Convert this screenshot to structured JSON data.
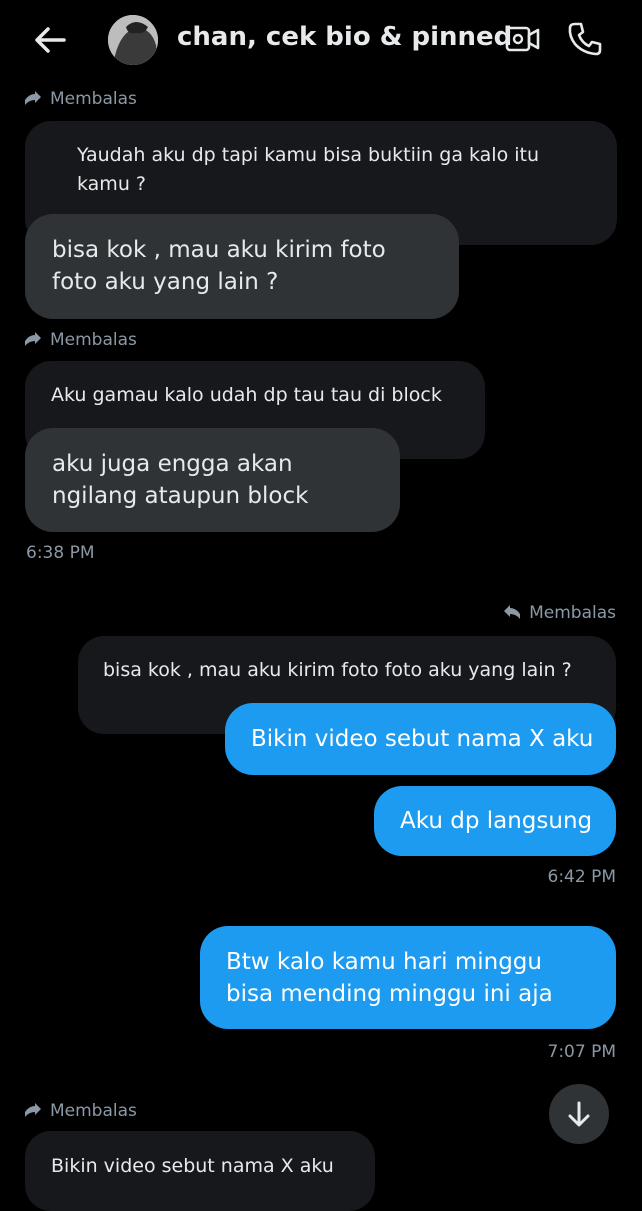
{
  "header": {
    "title": "chan, cek bio & pinned"
  },
  "messages": {
    "reply_label": "Membalas",
    "m1_quoted": "Yaudah aku dp tapi kamu bisa buktiin ga kalo itu kamu ?",
    "m1_text": "bisa kok , mau aku kirim foto foto aku yang lain ?",
    "m2_quoted": "Aku gamau kalo udah dp tau tau di block",
    "m2_text": "aku juga engga akan ngilang ataupun block",
    "time1": "6:38 PM",
    "m3_quoted": "bisa kok , mau aku kirim foto foto aku yang lain ?",
    "m3_text": "Bikin video sebut nama X aku",
    "m4_text": "Aku dp langsung",
    "time2": "6:42 PM",
    "m5_text": "Btw kalo kamu hari minggu bisa mending minggu ini aja",
    "time3": "7:07 PM",
    "m6_quoted": "Bikin video sebut nama X aku"
  },
  "colors": {
    "background": "#000000",
    "outgoing_bubble": "#1d9bf0",
    "incoming_bubble": "#2f3336",
    "quoted_bubble": "#16181c",
    "secondary_text": "#8b98a5"
  },
  "icons": [
    "back-arrow-icon",
    "video-call-icon",
    "phone-icon",
    "reply-arrow-icon",
    "scroll-down-arrow-icon"
  ]
}
